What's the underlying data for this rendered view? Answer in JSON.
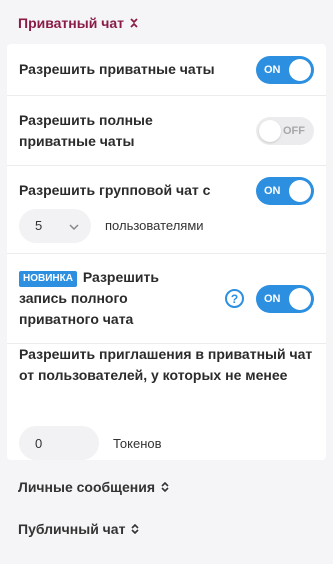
{
  "sections": {
    "private_chat": {
      "title": "Приватный чат",
      "chevron_icon": "collapse-chevron-icon"
    },
    "direct_messages": {
      "title": "Личные сообщения",
      "chevron_icon": "expand-chevron-icon"
    },
    "public_chat": {
      "title": "Публичный чат",
      "chevron_icon": "expand-chevron-icon"
    }
  },
  "settings": {
    "allow_private": {
      "label": "Разрешить приватные чаты",
      "toggle": "ON",
      "state": true
    },
    "allow_full_private": {
      "label": "Разрешить полные приватные чаты",
      "toggle": "OFF",
      "state": false
    },
    "allow_group": {
      "label": "Разрешить групповой чат с",
      "toggle": "ON",
      "state": true,
      "select_value": "5",
      "suffix": "пользователями"
    },
    "allow_recording": {
      "badge": "НОВИНКА",
      "label": "Разрешить запись полного приватного чата",
      "help": "?",
      "toggle": "ON",
      "state": true
    },
    "allow_invites": {
      "label": "Разрешить приглашения в приватный чат от пользователей, у которых не менее",
      "input_value": "0",
      "suffix": "Токенов"
    }
  },
  "colors": {
    "accent": "#2d8fe0",
    "header_active": "#8a1c47",
    "background": "#f5f5f7"
  }
}
